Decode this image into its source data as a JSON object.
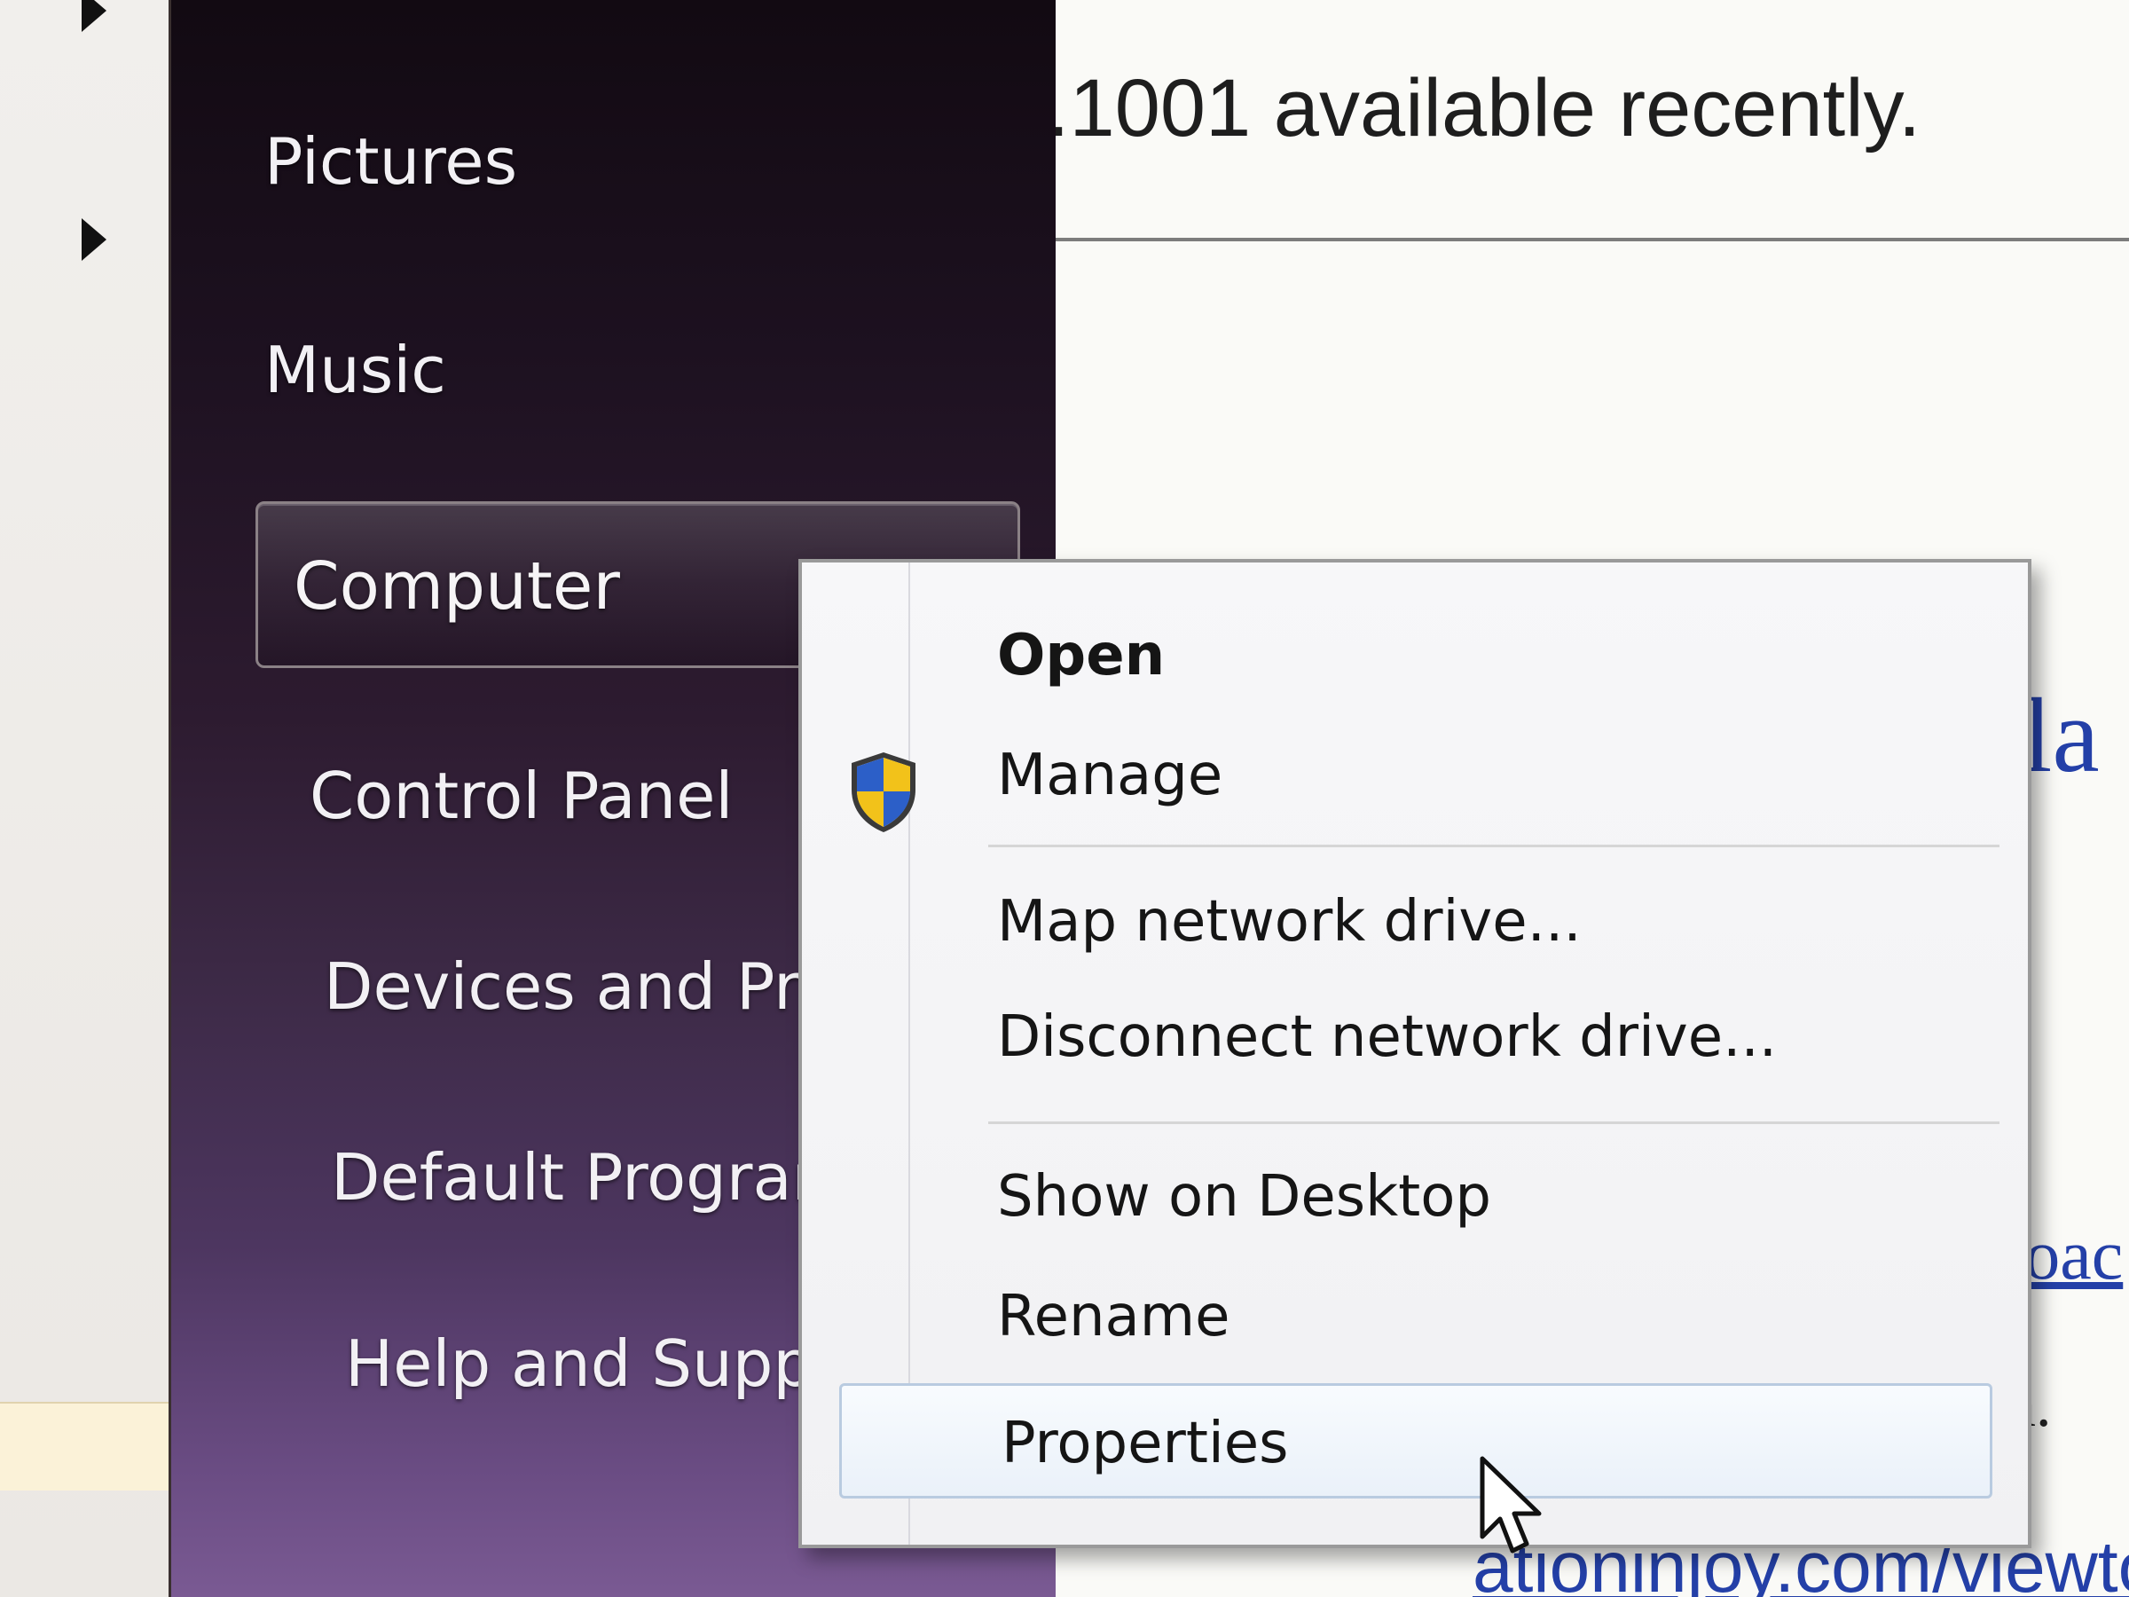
{
  "webpage": {
    "top_text": ".1001 available recently.",
    "heading_fragment": "la",
    "link_fragment": "loac",
    "text_fragment": "n.",
    "url_fragment": "ationinjoy.com/viewtop"
  },
  "start_menu": {
    "right_pane_items": [
      {
        "label": "Pictures"
      },
      {
        "label": "Music"
      },
      {
        "label": "Computer",
        "highlighted": true
      },
      {
        "label": "Control Panel"
      },
      {
        "label": "Devices and Prin"
      },
      {
        "label": "Default Program"
      },
      {
        "label": "Help and Suppor"
      }
    ]
  },
  "context_menu": {
    "items": [
      {
        "label": "Open",
        "default": true
      },
      {
        "label": "Manage",
        "icon": "uac-shield-icon"
      },
      {
        "label": "Map network drive..."
      },
      {
        "label": "Disconnect network drive..."
      },
      {
        "label": "Show on Desktop"
      },
      {
        "label": "Rename"
      },
      {
        "label": "Properties",
        "hovered": true
      }
    ]
  },
  "colors": {
    "pane_top": "#120a12",
    "pane_bottom": "#7a5a93",
    "link_blue": "#2440a8",
    "menu_background": "#f4f4f6"
  }
}
